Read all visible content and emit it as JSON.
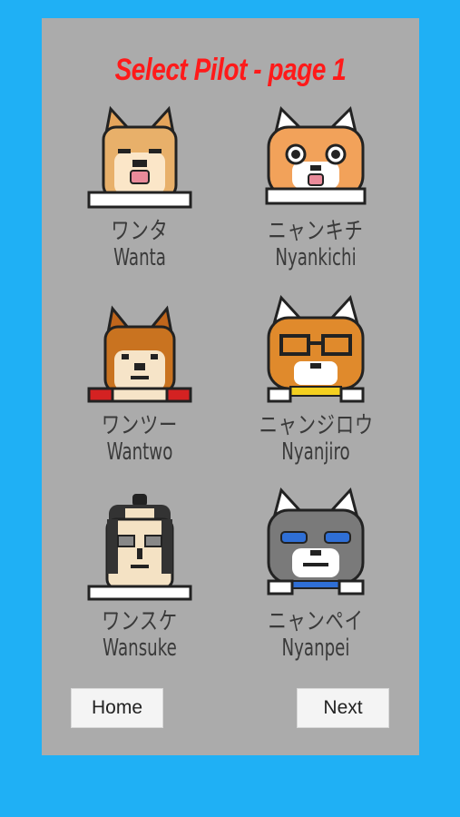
{
  "screen_title": "Select Pilot - page 1",
  "pilots": [
    {
      "jp": "ワンタ",
      "en": "Wanta",
      "icon": "shiba-dog-tan"
    },
    {
      "jp": "ニャンキチ",
      "en": "Nyankichi",
      "icon": "orange-tabby-cat"
    },
    {
      "jp": "ワンツー",
      "en": "Wantwo",
      "icon": "shiba-dog-brown"
    },
    {
      "jp": "ニャンジロウ",
      "en": "Nyanjiro",
      "icon": "tabby-cat-glasses"
    },
    {
      "jp": "ワンスケ",
      "en": "Wansuke",
      "icon": "samurai-man"
    },
    {
      "jp": "ニャンペイ",
      "en": "Nyanpei",
      "icon": "gray-cat"
    }
  ],
  "buttons": {
    "home": "Home",
    "next": "Next"
  },
  "colors": {
    "background": "#1fb0f5",
    "panel": "#ababab",
    "title": "#ff1a1a"
  }
}
